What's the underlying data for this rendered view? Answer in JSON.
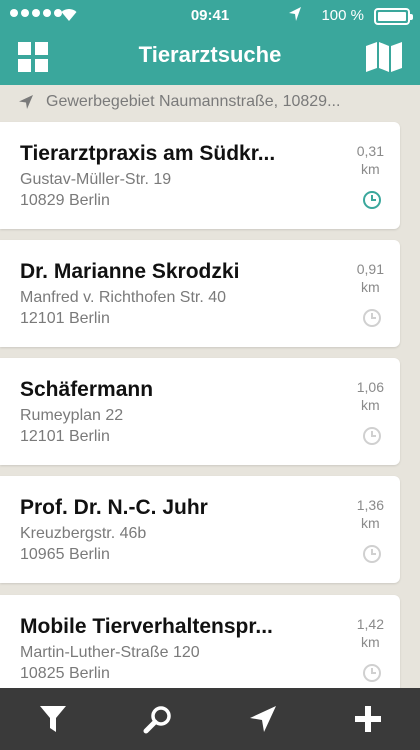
{
  "status_bar": {
    "time": "09:41",
    "battery": "100 %"
  },
  "nav": {
    "title": "Tierarztsuche"
  },
  "location": {
    "text": "Gewerbegebiet Naumannstraße, 10829..."
  },
  "results": [
    {
      "name": "Tierarztpraxis am Südkr...",
      "street": "Gustav-Müller-Str. 19",
      "city": "10829 Berlin",
      "distance": "0,31",
      "unit": "km",
      "open": true
    },
    {
      "name": "Dr. Marianne Skrodzki",
      "street": "Manfred v. Richthofen Str. 40",
      "city": "12101 Berlin",
      "distance": "0,91",
      "unit": "km",
      "open": false
    },
    {
      "name": "Schäfermann",
      "street": "Rumeyplan 22",
      "city": "12101 Berlin",
      "distance": "1,06",
      "unit": "km",
      "open": false
    },
    {
      "name": "Prof. Dr. N.-C. Juhr",
      "street": "Kreuzbergstr. 46b",
      "city": "10965 Berlin",
      "distance": "1,36",
      "unit": "km",
      "open": false
    },
    {
      "name": "Mobile Tierverhaltenspr...",
      "street": "Martin-Luther-Straße 120",
      "city": "10825 Berlin",
      "distance": "1,42",
      "unit": "km",
      "open": false
    }
  ],
  "tabs": [
    {
      "icon": "filter-icon"
    },
    {
      "icon": "search-icon"
    },
    {
      "icon": "location-arrow-icon"
    },
    {
      "icon": "plus-icon"
    }
  ],
  "colors": {
    "accent": "#3aa79c",
    "tabbar": "#3a3a3a",
    "background": "#e7e4dc",
    "clock_open": "#3aa79c",
    "clock_closed": "#d0d0d0"
  }
}
